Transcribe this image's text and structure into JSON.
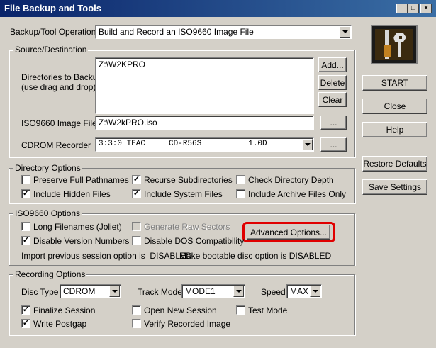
{
  "window": {
    "title": "File Backup and Tools",
    "minimize": "_",
    "maximize": "□",
    "close": "×"
  },
  "operation": {
    "label": "Backup/Tool Operation",
    "value": "Build and Record an ISO9660 Image File"
  },
  "source": {
    "group": "Source/Destination",
    "dirs_label_1": "Directories to Backup",
    "dirs_label_2": "(use drag and drop)",
    "dirs_list": [
      "Z:\\W2KPRO"
    ],
    "add": "Add...",
    "delete": "Delete",
    "clear": "Clear",
    "iso_label": "ISO9660 Image File",
    "iso_value": "Z:\\W2kPRO.iso",
    "iso_browse": "...",
    "cdrom_label": "CDROM Recorder",
    "cdrom_value": "3:3:0 TEAC     CD-R56S          1.0D",
    "cdrom_browse": "..."
  },
  "side": {
    "start": "START",
    "close": "Close",
    "help": "Help",
    "restore": "Restore Defaults",
    "save": "Save Settings"
  },
  "directory": {
    "group": "Directory Options",
    "preserve": {
      "label": "Preserve Full Pathnames",
      "checked": false
    },
    "recurse": {
      "label": "Recurse Subdirectories",
      "checked": true
    },
    "depth": {
      "label": "Check Directory Depth",
      "checked": false
    },
    "hidden": {
      "label": "Include Hidden Files",
      "checked": true
    },
    "system": {
      "label": "Include System Files",
      "checked": true
    },
    "archive": {
      "label": "Include Archive Files Only",
      "checked": false
    }
  },
  "iso": {
    "group": "ISO9660 Options",
    "long": {
      "label": "Long Filenames (Joliet)",
      "checked": false
    },
    "raw": {
      "label": "Generate Raw Sectors",
      "checked": false
    },
    "advanced": "Advanced Options...",
    "version": {
      "label": "Disable Version Numbers",
      "checked": true
    },
    "dos": {
      "label": "Disable DOS Compatibility",
      "checked": false
    },
    "import_status": "Import previous session option is  DISABLED",
    "boot_status": "Make bootable disc option is DISABLED"
  },
  "recording": {
    "group": "Recording Options",
    "disc_type_label": "Disc Type",
    "disc_type": "CDROM",
    "track_mode_label": "Track Mode",
    "track_mode": "MODE1",
    "speed_label": "Speed",
    "speed": "MAX",
    "finalize": {
      "label": "Finalize Session",
      "checked": true
    },
    "open_new": {
      "label": "Open New Session",
      "checked": false
    },
    "test": {
      "label": "Test Mode",
      "checked": false
    },
    "postgap": {
      "label": "Write Postgap",
      "checked": true
    },
    "verify": {
      "label": "Verify Recorded Image",
      "checked": false
    }
  },
  "colors": {
    "title_start": "#0a246a",
    "title_end": "#3a6ea5",
    "highlight": "#e00000",
    "face": "#d4d0c8"
  },
  "icons": {
    "tool_icon": "screwdriver-wrench-icon"
  }
}
